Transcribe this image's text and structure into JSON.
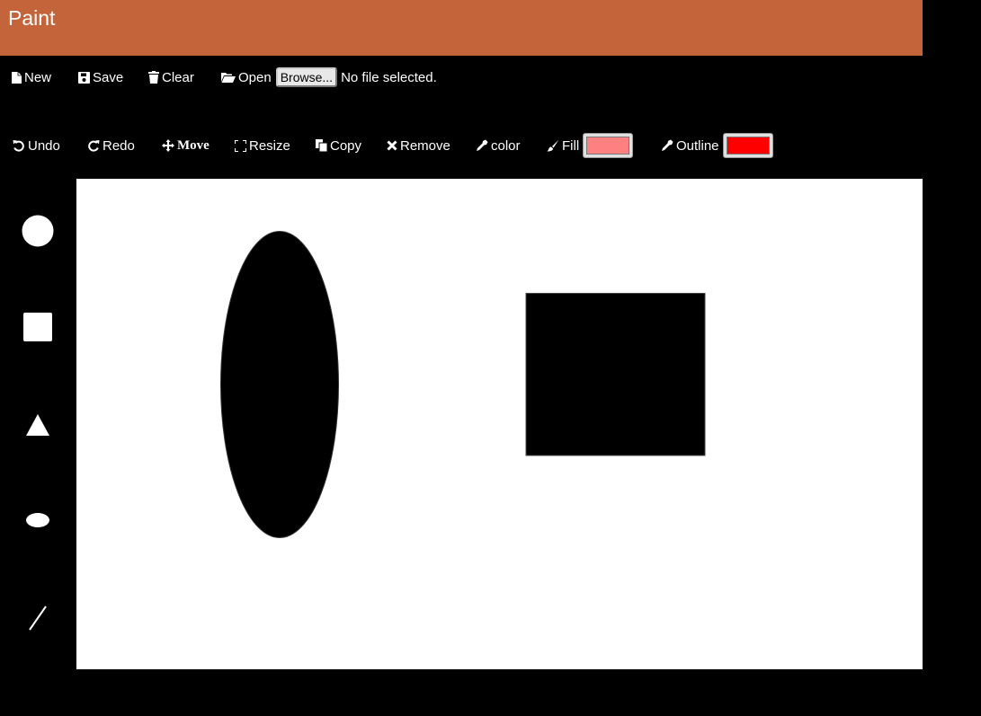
{
  "app": {
    "title": "Paint"
  },
  "file_toolbar": {
    "new_label": "New",
    "save_label": "Save",
    "clear_label": "Clear",
    "open_label": "Open",
    "browse_label": "Browse...",
    "file_status": "No file selected."
  },
  "edit_toolbar": {
    "undo_label": "Undo",
    "redo_label": "Redo",
    "move_label": "Move",
    "resize_label": "Resize",
    "copy_label": "Copy",
    "remove_label": "Remove",
    "color_label": "color",
    "fill_label": "Fill",
    "outline_label": "Outline"
  },
  "colors": {
    "title_bar": "#c4643a",
    "fill": "#ff8080",
    "outline": "#ff0000",
    "background": "#000000",
    "canvas": "#ffffff",
    "shape": "#000000"
  },
  "shape_tools": [
    "circle-icon",
    "square-icon",
    "triangle-icon",
    "ellipse-icon",
    "line-icon"
  ],
  "canvas_shapes": [
    "ellipse",
    "rectangle"
  ]
}
